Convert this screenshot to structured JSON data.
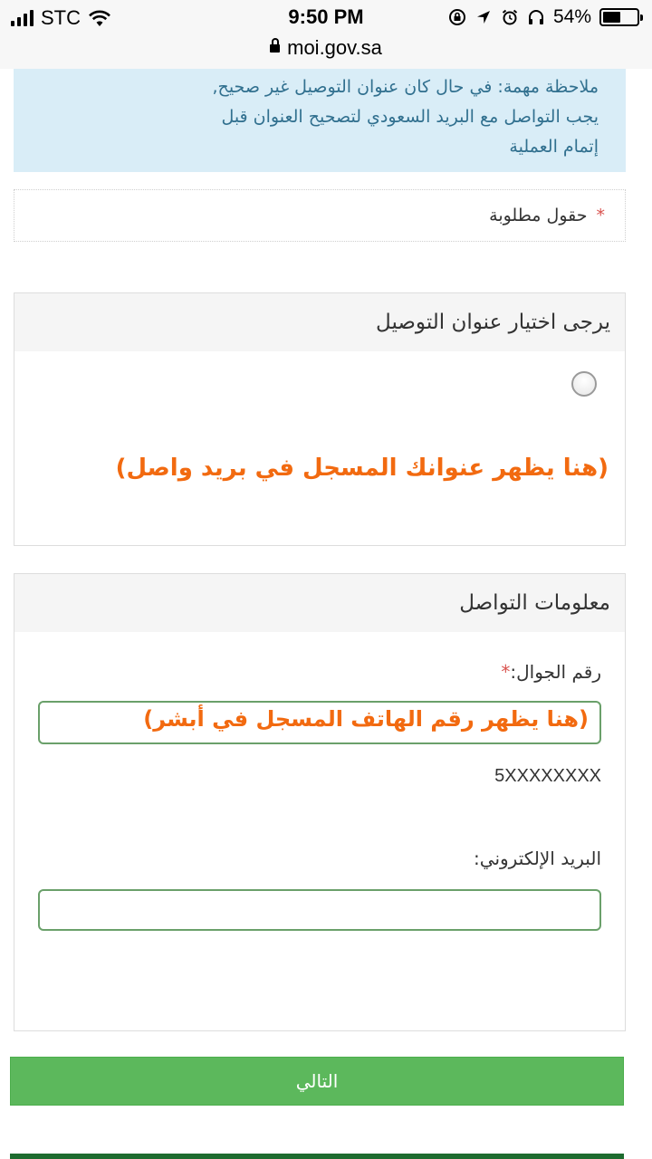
{
  "status_bar": {
    "carrier": "STC",
    "time": "9:50 PM",
    "battery_percent": "54%",
    "battery_level": 0.54,
    "icons": [
      "signal-icon",
      "wifi-icon",
      "screen-lock-icon",
      "location-arrow-icon",
      "alarm-icon",
      "headphones-icon",
      "battery-icon"
    ]
  },
  "browser": {
    "url": "moi.gov.sa",
    "lock_icon": "lock-icon"
  },
  "notice": {
    "line1": "ملاحظة مهمة: في حال كان عنوان التوصيل غير صحيح,",
    "line2": "يجب التواصل مع البريد السعودي لتصحيح العنوان قبل",
    "line3": "إتمام العملية"
  },
  "required_fields": {
    "star": "*",
    "label": "حقول مطلوبة"
  },
  "address_panel": {
    "title": "يرجى اختيار عنوان التوصيل",
    "annotation": "(هنا يظهر عنوانك المسجل في بريد واصل)"
  },
  "contact_panel": {
    "title": "معلومات التواصل",
    "mobile": {
      "label": "رقم الجوال:",
      "star": "*",
      "annotation": "(هنا يظهر رقم الهاتف المسجل في أبشر)",
      "value": "",
      "hint": "5XXXXXXXX"
    },
    "email": {
      "label": "البريد الإلكتروني:",
      "value": ""
    }
  },
  "buttons": {
    "next": "التالي"
  },
  "colors": {
    "notice_bg": "#d9edf7",
    "notice_text": "#31708f",
    "required_star": "#d9534f",
    "annotation": "#f26a10",
    "input_border": "#6aa06a",
    "next_button": "#5cb85c"
  }
}
